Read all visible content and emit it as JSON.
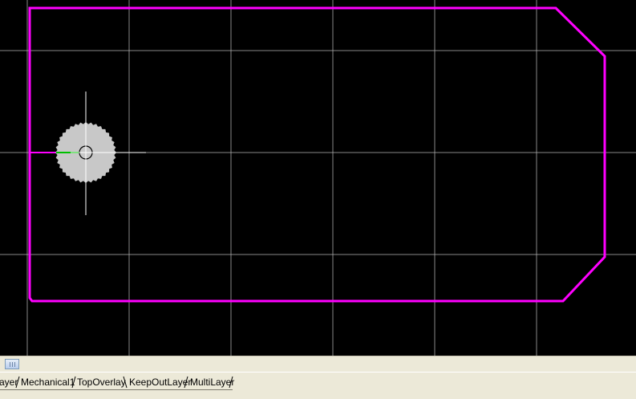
{
  "editor": {
    "name": "pcb-editor",
    "colors": {
      "background": "#000000",
      "grid": "#b4b4b4",
      "keepout_outline": "#ff00ff",
      "pad_fill": "#c8c8c8",
      "track": "#00c000"
    }
  },
  "scrollbar": {
    "icon": "scroll-thumb-grip-icon"
  },
  "layer_tabs": [
    {
      "id": "bottom-layer",
      "label": "ayer"
    },
    {
      "id": "mechanical1",
      "label": "Mechanical1"
    },
    {
      "id": "top-overlay",
      "label": "TopOverlay"
    },
    {
      "id": "keepout-layer",
      "label": "KeepOutLayer"
    },
    {
      "id": "multi-layer",
      "label": "MultiLayer"
    }
  ]
}
